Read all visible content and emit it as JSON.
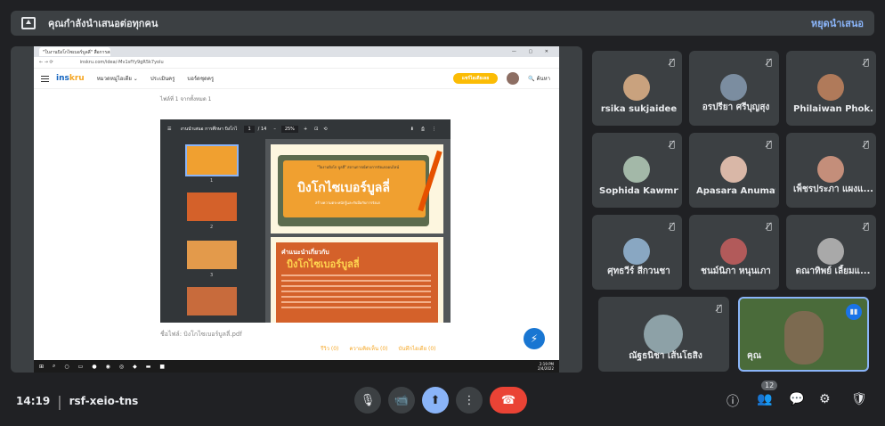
{
  "topbar": {
    "message": "คุณกำลังนำเสนอต่อทุกคน",
    "stop_label": "หยุดนำเสนอ"
  },
  "browser": {
    "tab_title": "\"ใบงานบิงโกไซเบอร์บูลลี่\" สื่อการสอน...",
    "window_controls": "— ▢ ✕",
    "url": "inskru.com/idea/-Mv1sfYy9gR5k7yolu",
    "site": {
      "logo_main": "ins",
      "logo_accent": "kru",
      "nav": [
        "หมวดหมู่ไอเดีย ⌄",
        "ประเมินครู",
        "บอร์ดชุดครู"
      ],
      "register_button": "แชร์ไอเดียเลย",
      "search": "ค้นหา"
    },
    "page_note": "ไฟล์ที่ 1 จากทั้งหมด 1",
    "pdf_viewer": {
      "file_name": "งานนำเสนอ การศึกษา บิงโกไซ...",
      "page_current": "1",
      "page_total": "/ 14",
      "zoom": "25%",
      "thumb_numbers": [
        "1",
        "2",
        "3"
      ],
      "page1": {
        "subtitle": "\"ใบงานบิงโก บูลลี่\" สถานการณ์ทางการรังแกออนไลน์",
        "title": "บิงโกไซเบอร์บูลลี่",
        "tagline": "สร้างความตระหนักรู้และรับมือกับการรังแก"
      },
      "page2": {
        "heading": "คำแนะนำเกี่ยวกับ",
        "title": "บิงโกไซเบอร์บูลลี่"
      }
    },
    "file_line": "ชื่อไฟล์: บิงโกไซเบอร์บูลลี่.pdf",
    "actions": [
      "รีวิว (0)",
      "ความคิดเห็น (0)",
      "บันทึกไอเดีย (0)"
    ],
    "taskbar_clock": [
      "2:19 PM",
      "2/4/2022"
    ]
  },
  "participants": [
    {
      "name": "rsika sukjaidee",
      "avatar_color": "#c9a27e"
    },
    {
      "name": "อรปรียา ศรีบุญสุง",
      "avatar_color": "#7b8da0"
    },
    {
      "name": "Philaiwan Phok...",
      "avatar_color": "#b07a5a"
    },
    {
      "name": "Sophida Kawmrt",
      "avatar_color": "#a3b8a8"
    },
    {
      "name": "Apasara Anumat",
      "avatar_color": "#d9b7a7"
    },
    {
      "name": "เพ็ชรประภา แผงแ...",
      "avatar_color": "#c48e7a"
    },
    {
      "name": "ศุทธวีร์ สีกวนชา",
      "avatar_color": "#89a7c2"
    },
    {
      "name": "ชนม์นิภา หนุนเภา",
      "avatar_color": "#b25a5a"
    },
    {
      "name": "ดณาทิพย์ เลี้ยมแ...",
      "avatar_color": "#a9a9a9"
    },
    {
      "name": "ณัฐธนิชา เส้นโธสิง",
      "avatar_color": "#8da1a7"
    },
    {
      "name": "คุณ",
      "avatar_color": "#7c6a50"
    }
  ],
  "bottom": {
    "time": "14:19",
    "separator": "|",
    "meeting_code": "rsf-xeio-tns",
    "participant_count": "12"
  },
  "icons": {
    "mic": "🎙",
    "camera": "📹",
    "present": "⬆",
    "more": "⋮",
    "end": "☎",
    "info": "ⓘ",
    "people": "👥",
    "chat": "💬",
    "activities": "⚙",
    "safety": "🛡",
    "mute": "🎙̸"
  },
  "colors": {
    "accent": "#8ab4f8",
    "end_call": "#ea4335",
    "bg": "#202124",
    "tile": "#3c4043"
  }
}
